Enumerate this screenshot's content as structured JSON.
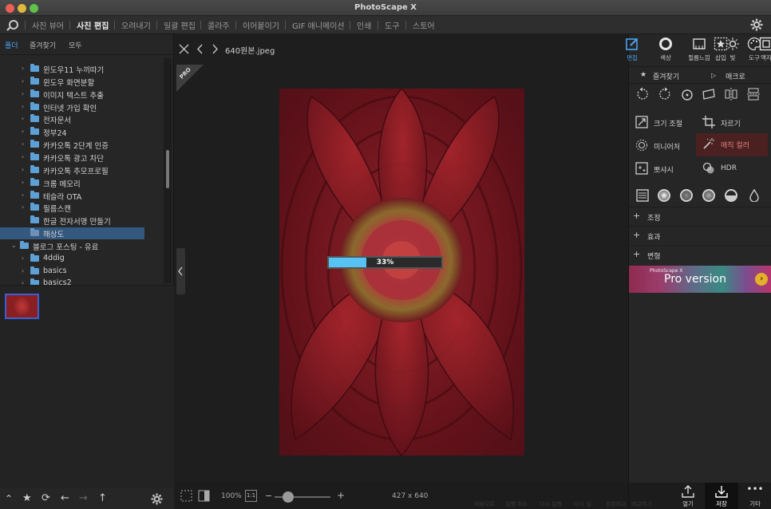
{
  "window": {
    "title": "PhotoScape X"
  },
  "menu": {
    "items": [
      "사진 뷰어",
      "사진 편집",
      "오려내기",
      "일괄 편집",
      "콜라주",
      "이어붙이기",
      "GIF 애니메이션",
      "인쇄",
      "도구",
      "스토어"
    ],
    "active": "사진 편집",
    "icons": {
      "logo": "photoscape-logo-icon",
      "settings": "gear-icon"
    }
  },
  "left_panel": {
    "tabs": [
      "폴더",
      "즐겨찾기",
      "모두"
    ],
    "tree": [
      {
        "label": "윈도우11 누끼따기",
        "indent": 1,
        "expandable": true
      },
      {
        "label": "윈도우 화면분할",
        "indent": 1,
        "expandable": true
      },
      {
        "label": "이미지 텍스트 추출",
        "indent": 1,
        "expandable": true
      },
      {
        "label": "인터넷 가입 확인",
        "indent": 1,
        "expandable": true
      },
      {
        "label": "전자문서",
        "indent": 1,
        "expandable": true
      },
      {
        "label": "정부24",
        "indent": 1,
        "expandable": true
      },
      {
        "label": "카카오톡 2단계 인증",
        "indent": 1,
        "expandable": true
      },
      {
        "label": "카카오톡 광고 차단",
        "indent": 1,
        "expandable": true
      },
      {
        "label": "카카오톡 추모프로필",
        "indent": 1,
        "expandable": true
      },
      {
        "label": "크롬 메모리",
        "indent": 1,
        "expandable": true
      },
      {
        "label": "테슬라 OTA",
        "indent": 1,
        "expandable": true
      },
      {
        "label": "필름스캔",
        "indent": 1,
        "expandable": true
      },
      {
        "label": "한글 전자서명 만들기",
        "indent": 1,
        "expandable": false
      },
      {
        "label": "해상도",
        "indent": 1,
        "expandable": false,
        "selected": true
      },
      {
        "label": "블로그 포스팅 - 유료",
        "indent": 0,
        "expandable": true,
        "expanded": true
      },
      {
        "label": "4ddig",
        "indent": 1,
        "expandable": true
      },
      {
        "label": "basics",
        "indent": 1,
        "expandable": true
      },
      {
        "label": "basics2",
        "indent": 1,
        "expandable": true
      }
    ],
    "bottom_icons": [
      "chevron-up-icon",
      "star-icon",
      "refresh-icon",
      "arrow-left-icon",
      "arrow-right-icon",
      "arrow-up-icon",
      "gear-icon"
    ]
  },
  "editor": {
    "filename": "640원본.jpeg",
    "badge": "PRO",
    "progress_label": "33%",
    "progress_value": 0.33,
    "zoom": "100%",
    "one_to_one": "1:1",
    "dimensions": "427 x 640",
    "minus": "−",
    "plus": "+"
  },
  "right_panel": {
    "tools": [
      {
        "label": "편집",
        "icon": "edit-icon",
        "active": true
      },
      {
        "label": "색상",
        "icon": "color-circle-icon"
      },
      {
        "label": "필름느낌",
        "icon": "film-icon"
      },
      {
        "label": "빛",
        "icon": "sun-icon"
      },
      {
        "label": "액자",
        "icon": "frame-icon"
      },
      {
        "label": "삽입",
        "icon": "insert-icon"
      },
      {
        "label": "도구",
        "icon": "palette-icon"
      }
    ],
    "favorites": "즐겨찾기",
    "macro": "매크로",
    "buttons": [
      {
        "label": "크기 조절",
        "icon": "resize-icon"
      },
      {
        "label": "자르기",
        "icon": "crop-icon"
      },
      {
        "label": "미니어처",
        "icon": "miniature-icon"
      },
      {
        "label": "매직 컬러",
        "icon": "magic-wand-icon"
      },
      {
        "label": "뽀샤시",
        "icon": "bloom-icon"
      },
      {
        "label": "HDR",
        "icon": "hdr-icon"
      }
    ],
    "sections": [
      "조정",
      "효과",
      "변형"
    ],
    "promo": {
      "brand": "PhotoScape X",
      "text": "Pro version"
    }
  },
  "bottom_actions": {
    "ghost": [
      "처음으로",
      "실행 취소",
      "다시 실행",
      "다시 실..",
      "원본비교",
      "비교하기"
    ],
    "items": [
      {
        "label": "열기",
        "icon": "open-icon"
      },
      {
        "label": "저장",
        "icon": "save-icon"
      },
      {
        "label": "기타",
        "icon": "more-icon"
      }
    ]
  }
}
